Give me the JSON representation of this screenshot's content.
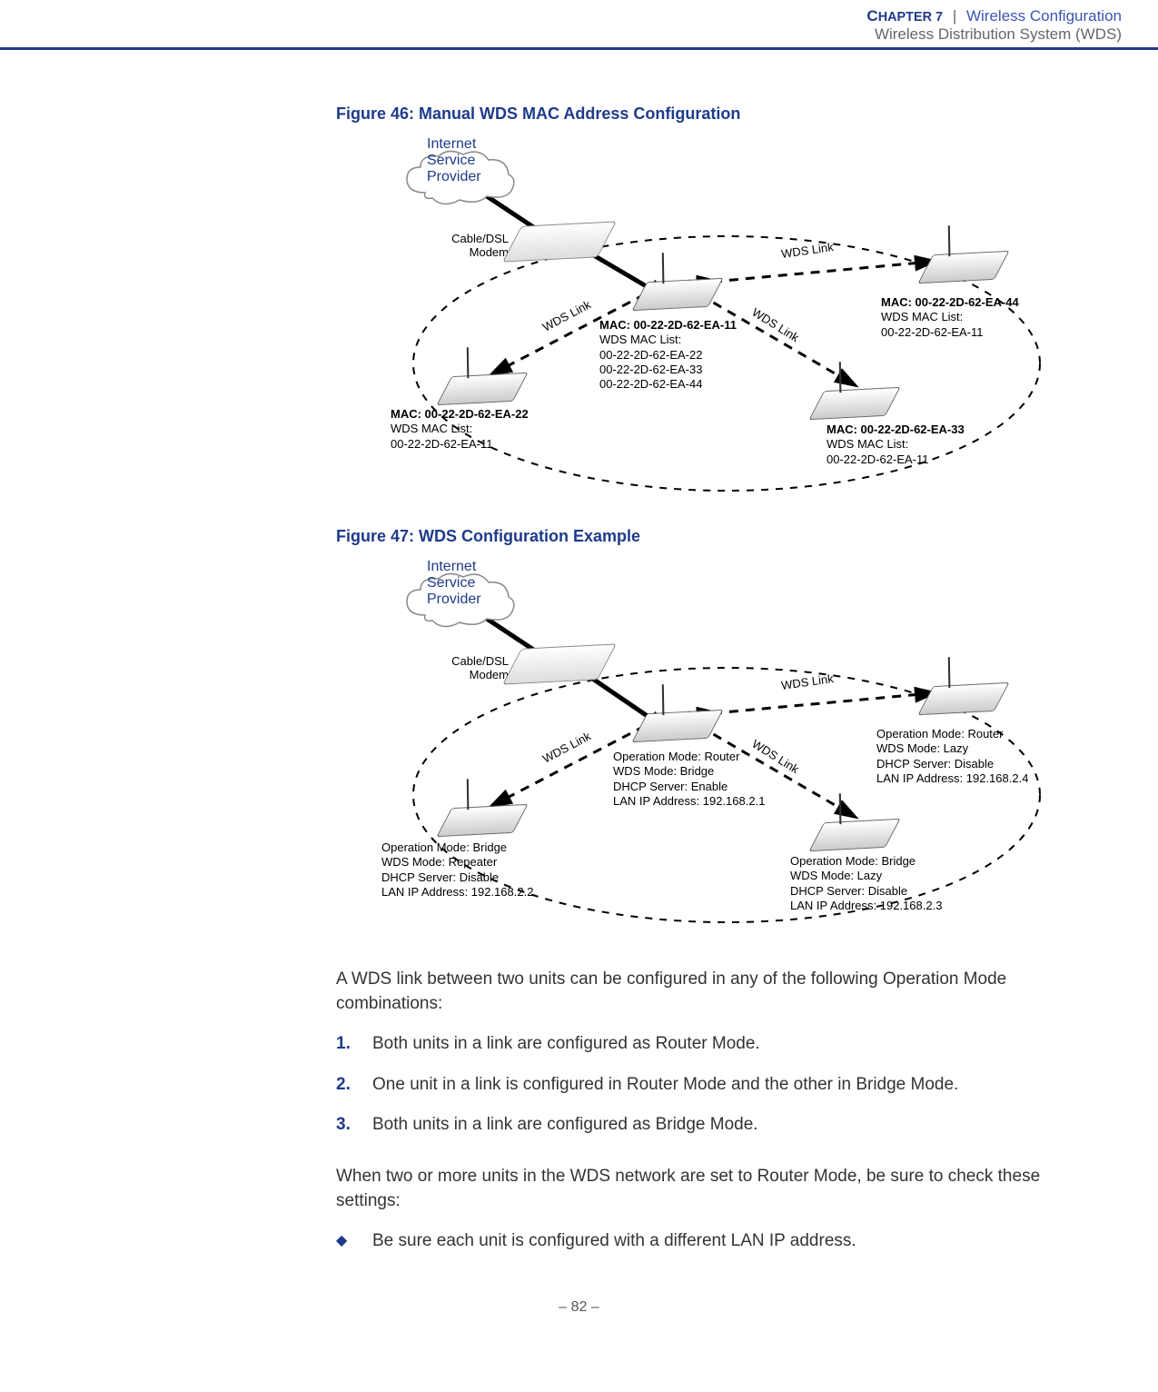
{
  "header": {
    "chapter_small": "C",
    "chapter_rest": "HAPTER 7",
    "chapter_title": "Wireless Configuration",
    "section_title": "Wireless Distribution System (WDS)"
  },
  "fig46": {
    "caption": "Figure 46:  Manual WDS MAC Address Configuration",
    "isp": "Internet\nService\nProvider",
    "modem": "Cable/DSL\nModem",
    "wds_link_label": "WDS Link",
    "nodes": {
      "center": {
        "title": "MAC: 00-22-2D-62-EA-11",
        "sub": "WDS MAC List:",
        "items": [
          "00-22-2D-62-EA-22",
          "00-22-2D-62-EA-33",
          "00-22-2D-62-EA-44"
        ]
      },
      "left": {
        "title": "MAC: 00-22-2D-62-EA-22",
        "sub": "WDS MAC List:",
        "items": [
          "00-22-2D-62-EA-11"
        ]
      },
      "bottom_right": {
        "title": "MAC: 00-22-2D-62-EA-33",
        "sub": "WDS MAC List:",
        "items": [
          "00-22-2D-62-EA-11"
        ]
      },
      "top_right": {
        "title": "MAC: 00-22-2D-62-EA-44",
        "sub": "WDS MAC List:",
        "items": [
          "00-22-2D-62-EA-11"
        ]
      }
    }
  },
  "fig47": {
    "caption": "Figure 47:  WDS Configuration Example",
    "isp": "Internet\nService\nProvider",
    "modem": "Cable/DSL\nModem",
    "wds_link_label": "WDS Link",
    "nodes": {
      "center": {
        "lines": [
          "Operation Mode: Router",
          "WDS Mode: Bridge",
          "DHCP Server: Enable",
          "LAN IP Address: 192.168.2.1"
        ]
      },
      "left": {
        "lines": [
          "Operation Mode: Bridge",
          "WDS Mode: Repeater",
          "DHCP Server: Disable",
          "LAN IP Address: 192.168.2.2"
        ]
      },
      "bottom_right": {
        "lines": [
          "Operation Mode: Bridge",
          "WDS Mode: Lazy",
          "DHCP Server: Disable",
          "LAN IP Address: 192.168.2.3"
        ]
      },
      "top_right": {
        "lines": [
          "Operation Mode: Router",
          "WDS Mode: Lazy",
          "DHCP Server: Disable",
          "LAN IP Address: 192.168.2.4"
        ]
      }
    }
  },
  "body": {
    "intro": "A WDS link between two units can be configured in any of the following Operation Mode combinations:",
    "steps": [
      "Both units in a link are configured as Router Mode.",
      "One unit in a link is configured in Router Mode and the other in Bridge Mode.",
      "Both units in a link are configured as Bridge Mode."
    ],
    "followup": "When two or more units in the WDS network are set to Router Mode, be sure to check these settings:",
    "bullets": [
      "Be sure each unit is configured with a different LAN IP address."
    ]
  },
  "page": "–  82  –"
}
